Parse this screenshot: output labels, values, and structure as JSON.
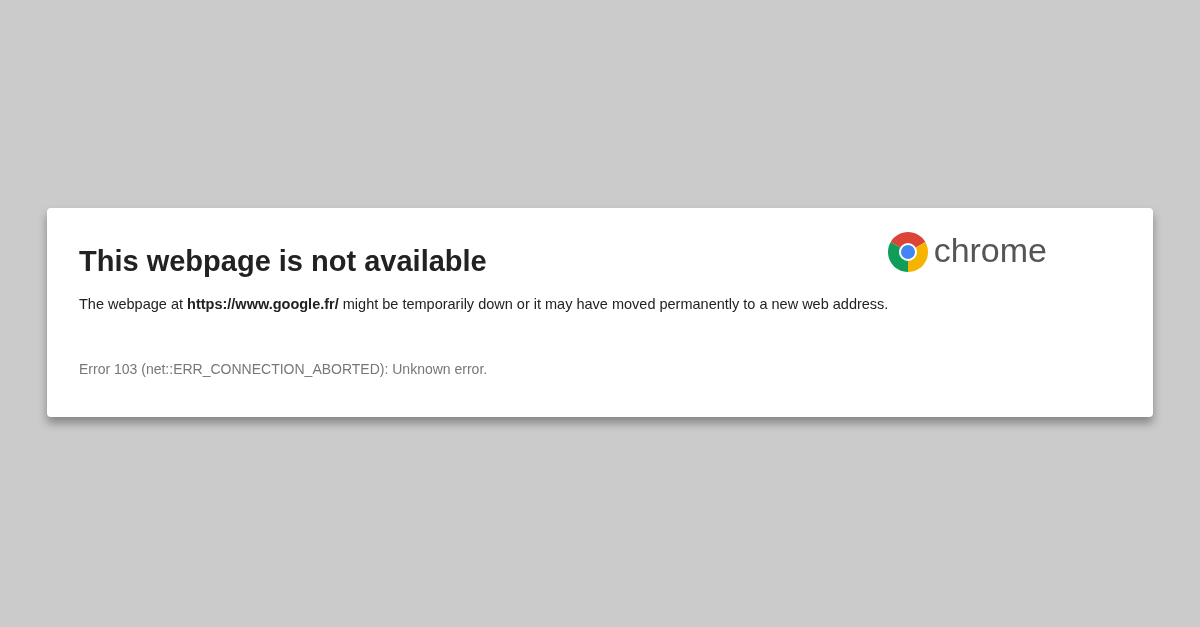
{
  "error_card": {
    "title": "This webpage is not available",
    "logo_text": "chrome",
    "message": "The webpage at **https://www.google.fr/** might be temporarily down or it may have moved permanently to a new web address.",
    "error_detail": "Error 103 (net::ERR_CONNECTION_ABORTED): Unknown error."
  }
}
